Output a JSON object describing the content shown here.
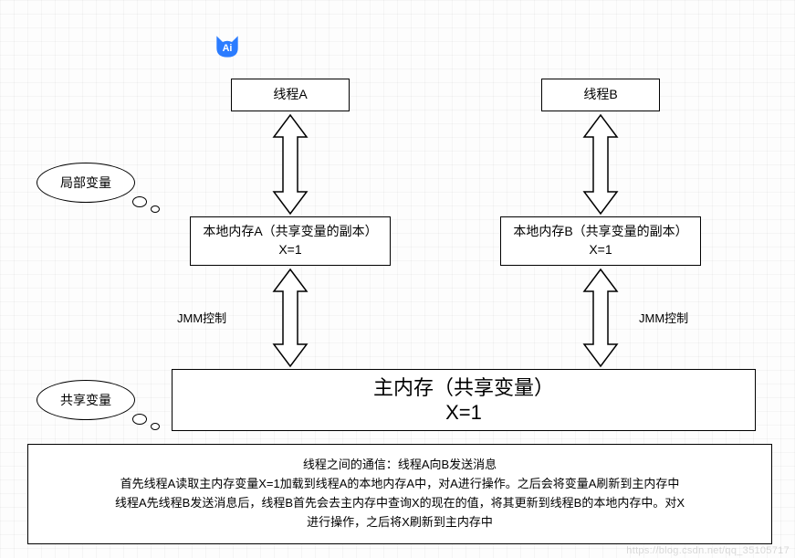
{
  "logo_text": "Ai",
  "threadA": "线程A",
  "threadB": "线程B",
  "localMemA_line1": "本地内存A（共享变量的副本）",
  "localMemA_line2": "X=1",
  "localMemB_line1": "本地内存B（共享变量的副本）",
  "localMemB_line2": "X=1",
  "mainMem_line1": "主内存（共享变量）",
  "mainMem_line2": "X=1",
  "jmm_label_left": "JMM控制",
  "jmm_label_right": "JMM控制",
  "bubble_local": "局部变量",
  "bubble_shared": "共享变量",
  "desc_line1": "线程之间的通信：线程A向B发送消息",
  "desc_line2": "首先线程A读取主内存变量X=1加载到线程A的本地内存A中，对A进行操作。之后会将变量A刷新到主内存中",
  "desc_line3": "线程A先线程B发送消息后，线程B首先会去主内存中查询X的现在的值，将其更新到线程B的本地内存中。对X",
  "desc_line4": "进行操作，之后将X刷新到主内存中",
  "watermark": "https://blog.csdn.net/qq_35105717"
}
